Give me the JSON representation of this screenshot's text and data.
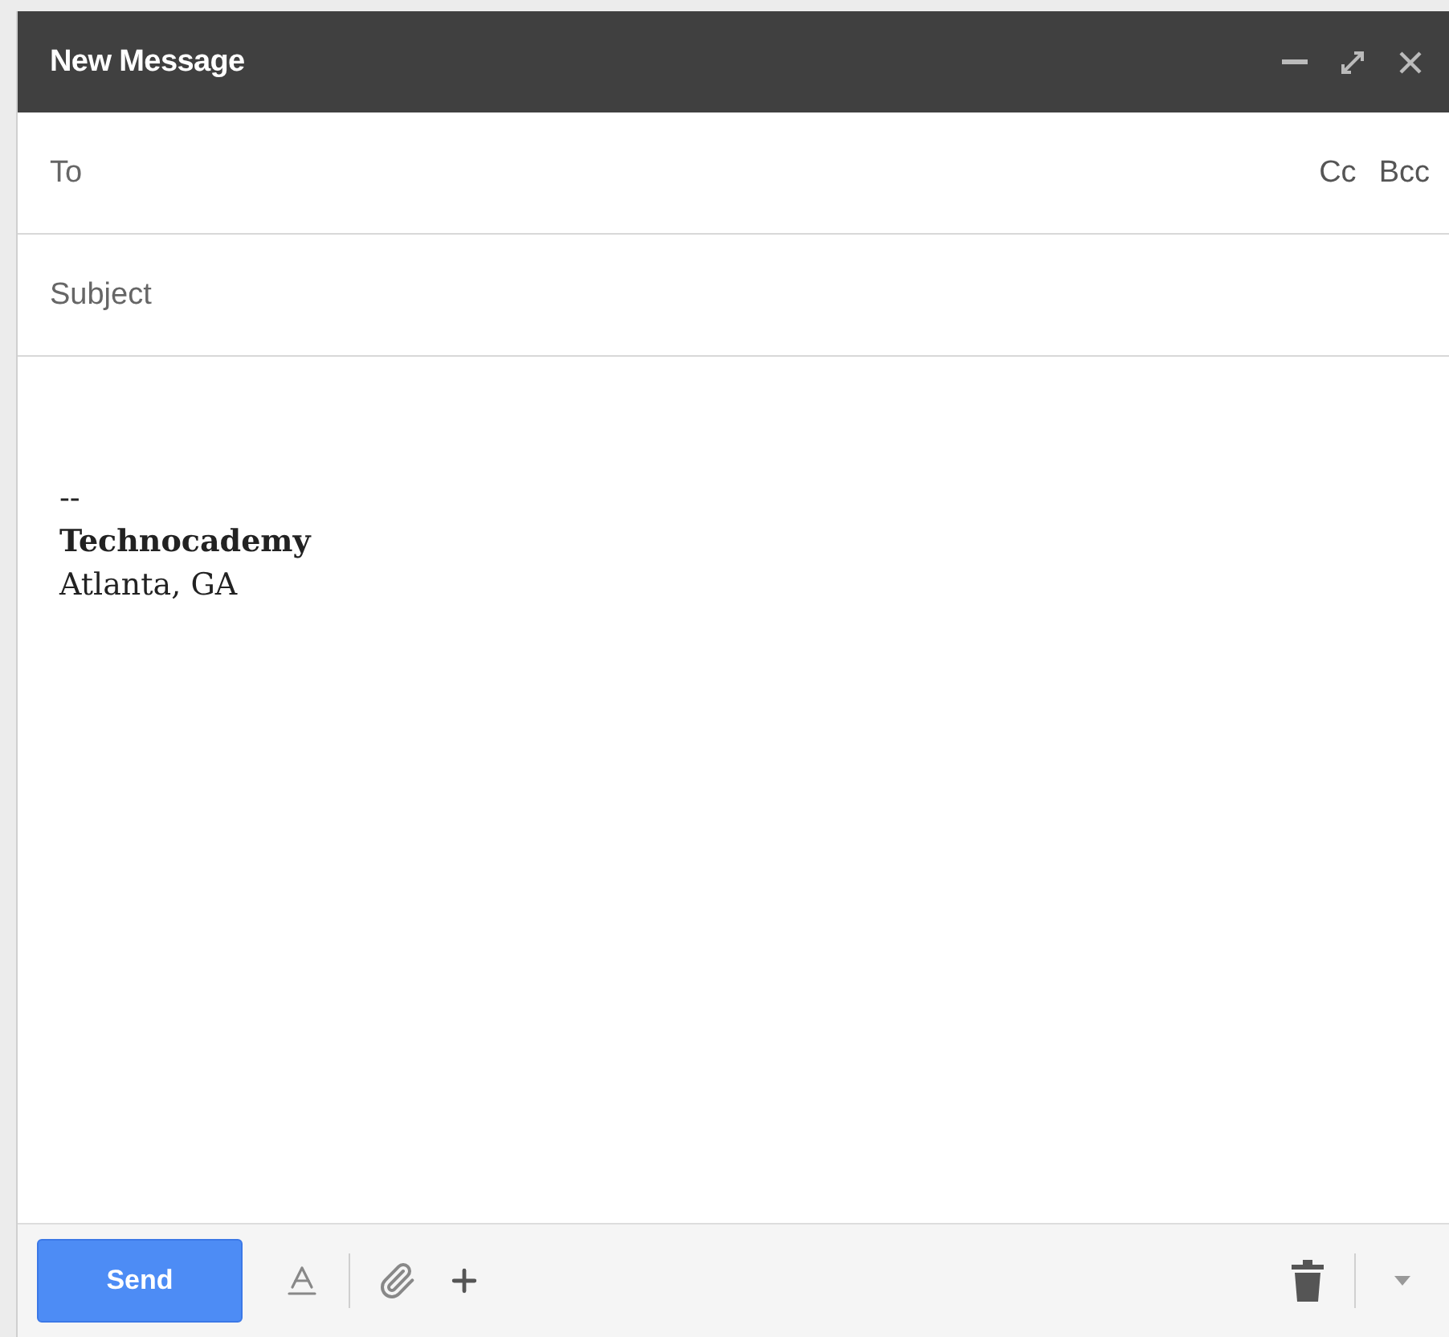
{
  "window": {
    "title": "New Message"
  },
  "fields": [
    {
      "kind": "recipients",
      "placeholder": "To",
      "links": [
        "Cc",
        "Bcc"
      ]
    },
    {
      "kind": "subject",
      "placeholder": "Subject"
    }
  ],
  "signature": {
    "separator": "--",
    "name": "Technocademy",
    "location": "Atlanta, GA"
  },
  "footer": {
    "send_label": "Send"
  }
}
